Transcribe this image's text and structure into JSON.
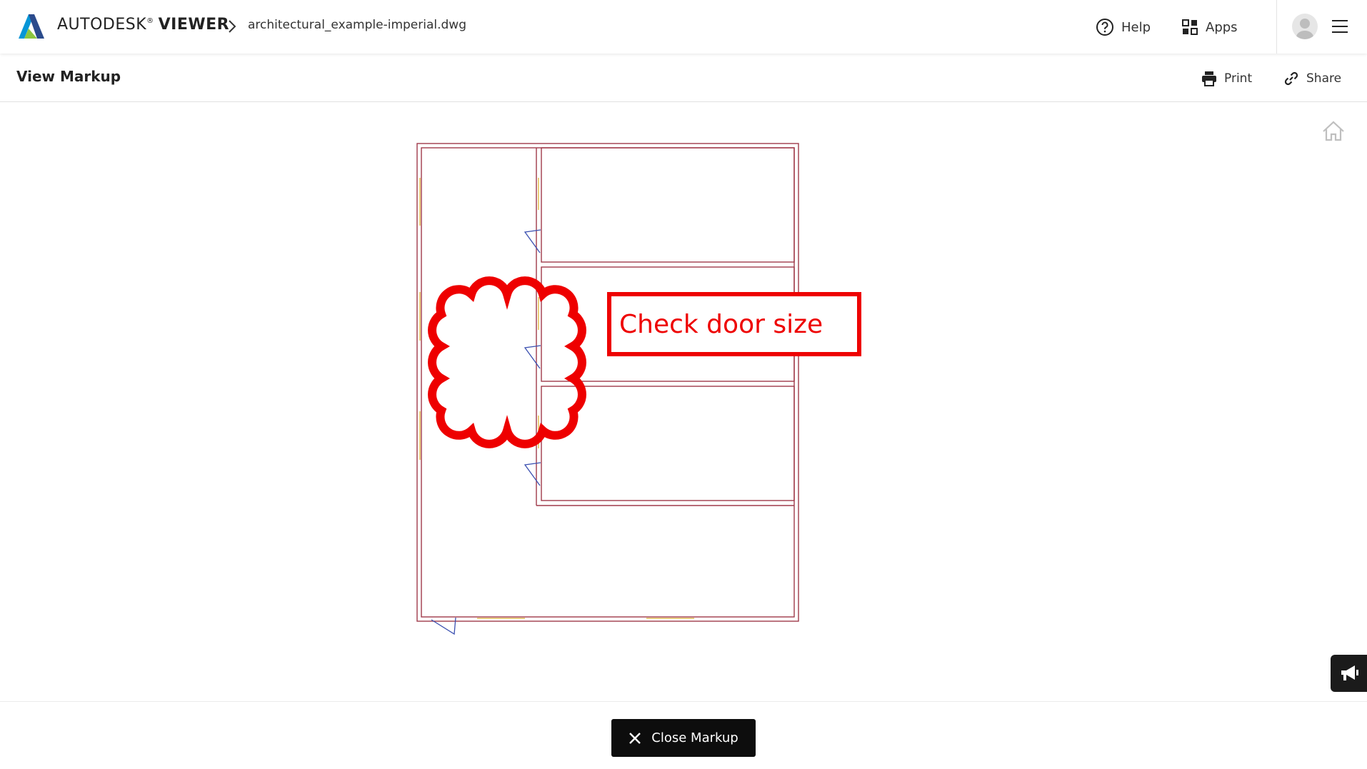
{
  "header": {
    "brand_name": "AUTODESK",
    "brand_mark": "®",
    "brand_product": "VIEWER",
    "filename": "architectural_example-imperial.dwg",
    "help_label": "Help",
    "apps_label": "Apps",
    "icons": [
      "autodesk-logo",
      "chevron-right-icon",
      "help-circle-icon",
      "apps-grid-icon",
      "user-avatar",
      "hamburger-menu-icon"
    ]
  },
  "toolbar": {
    "title": "View Markup",
    "print_label": "Print",
    "share_label": "Share",
    "icons": [
      "printer-icon",
      "link-icon"
    ]
  },
  "canvas": {
    "markup_text": "Check door size",
    "markup_color": "#ee0000",
    "wall_color": "#a03a4a",
    "door_color": "#3a4fb0",
    "window_color": "#e4c25a",
    "icons": [
      "home-icon",
      "megaphone-icon"
    ]
  },
  "footer": {
    "close_label": "Close Markup",
    "icons": [
      "close-x-icon"
    ]
  }
}
